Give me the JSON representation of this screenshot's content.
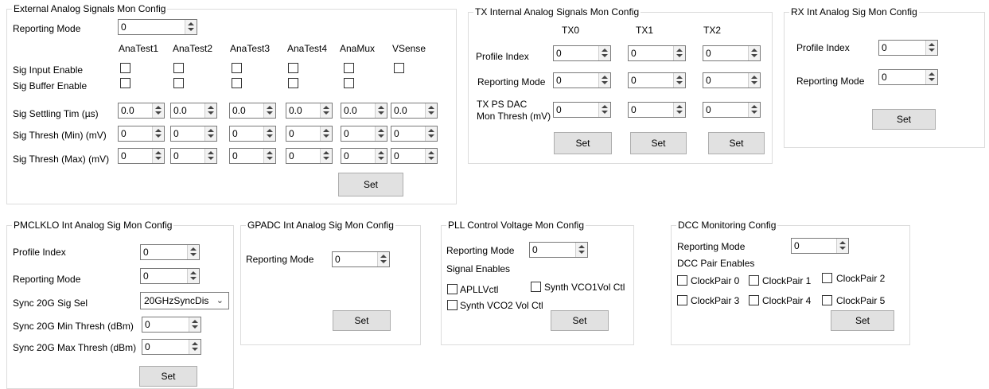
{
  "ext": {
    "title": "External Analog Signals Mon Config",
    "reporting_mode_label": "Reporting Mode",
    "reporting_mode_value": "0",
    "columns": [
      "AnaTest1",
      "AnaTest2",
      "AnaTest3",
      "AnaTest4",
      "AnaMux",
      "VSense"
    ],
    "sig_input_enable": "Sig Input Enable",
    "sig_buffer_enable": "Sig Buffer Enable",
    "settling_label": "Sig Settling Tim (µs)",
    "settling_values": [
      "0.0",
      "0.0",
      "0.0",
      "0.0",
      "0.0",
      "0.0"
    ],
    "thresh_min_label": "Sig Thresh (Min) (mV)",
    "thresh_min_values": [
      "0",
      "0",
      "0",
      "0",
      "0",
      "0"
    ],
    "thresh_max_label": "Sig Thresh (Max) (mV)",
    "thresh_max_values": [
      "0",
      "0",
      "0",
      "0",
      "0",
      "0"
    ],
    "set": "Set"
  },
  "tx": {
    "title": "TX Internal Analog Signals Mon Config",
    "columns": [
      "TX0",
      "TX1",
      "TX2"
    ],
    "profile_index_label": "Profile Index",
    "profile_index_values": [
      "0",
      "0",
      "0"
    ],
    "reporting_mode_label": "Reporting Mode",
    "reporting_mode_values": [
      "0",
      "0",
      "0"
    ],
    "dac_label_1": "TX PS DAC",
    "dac_label_2": "Mon Thresh (mV)",
    "dac_values": [
      "0",
      "0",
      "0"
    ],
    "set": "Set"
  },
  "rx": {
    "title": "RX Int Analog Sig Mon Config",
    "profile_index_label": "Profile Index",
    "profile_index_value": "0",
    "reporting_mode_label": "Reporting Mode",
    "reporting_mode_value": "0",
    "set": "Set"
  },
  "pm": {
    "title": "PMCLKLO Int Analog Sig Mon Config",
    "profile_index_label": "Profile Index",
    "profile_index_value": "0",
    "reporting_mode_label": "Reporting Mode",
    "reporting_mode_value": "0",
    "sync_sel_label": "Sync 20G Sig Sel",
    "sync_sel_value": "20GHzSyncDis",
    "min_label": "Sync 20G Min Thresh (dBm)",
    "min_value": "0",
    "max_label": "Sync 20G Max Thresh (dBm)",
    "max_value": "0",
    "set": "Set"
  },
  "gpadc": {
    "title": "GPADC Int Analog Sig Mon Config",
    "reporting_mode_label": "Reporting Mode",
    "reporting_mode_value": "0",
    "set": "Set"
  },
  "pll": {
    "title": "PLL Control Voltage Mon Config",
    "reporting_mode_label": "Reporting Mode",
    "reporting_mode_value": "0",
    "signal_enables": "Signal Enables",
    "apll": "APLLVctl",
    "synth1": "Synth VCO1Vol Ctl",
    "synth2": "Synth VCO2 Vol Ctl",
    "set": "Set"
  },
  "dcc": {
    "title": "DCC Monitoring Config",
    "reporting_mode_label": "Reporting Mode",
    "reporting_mode_value": "0",
    "pair_enables": "DCC Pair Enables",
    "pairs": [
      "ClockPair 0",
      "ClockPair 1",
      "ClockPair 2",
      "ClockPair 3",
      "ClockPair 4",
      "ClockPair 5"
    ],
    "set": "Set"
  }
}
